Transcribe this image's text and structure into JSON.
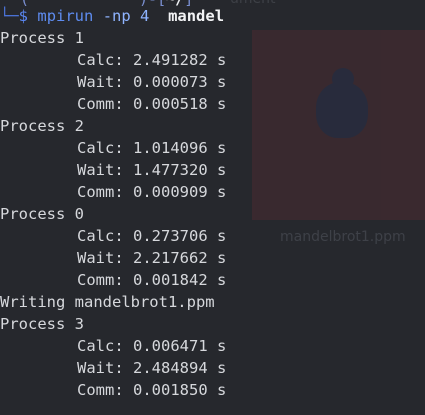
{
  "desktop": {
    "caption": "mandelbrot1.ppm",
    "top_fragment": "ument"
  },
  "prompt": {
    "fragment_left": "(",
    "fragment_mid": ")-[",
    "fragment_bright": "~/",
    "fragment_right": "]",
    "corner": "└─",
    "symbol": "$",
    "command": "mpirun",
    "flag": "-np",
    "count": "4",
    "program": "mandel"
  },
  "output": [
    {
      "text": "Process 1",
      "indent": false
    },
    {
      "text": "Calc: 2.491282 s",
      "indent": true
    },
    {
      "text": "Wait: 0.000073 s",
      "indent": true
    },
    {
      "text": "Comm: 0.000518 s",
      "indent": true
    },
    {
      "text": "Process 2",
      "indent": false
    },
    {
      "text": "Calc: 1.014096 s",
      "indent": true
    },
    {
      "text": "Wait: 1.477320 s",
      "indent": true
    },
    {
      "text": "Comm: 0.000909 s",
      "indent": true
    },
    {
      "text": "Process 0",
      "indent": false
    },
    {
      "text": "Calc: 0.273706 s",
      "indent": true
    },
    {
      "text": "Wait: 2.217662 s",
      "indent": true
    },
    {
      "text": "Comm: 0.001842 s",
      "indent": true
    },
    {
      "text": "Writing mandelbrot1.ppm",
      "indent": false
    },
    {
      "text": "Process 3",
      "indent": false
    },
    {
      "text": "Calc: 0.006471 s",
      "indent": true
    },
    {
      "text": "Wait: 2.484894 s",
      "indent": true
    },
    {
      "text": "Comm: 0.001850 s",
      "indent": true
    }
  ]
}
